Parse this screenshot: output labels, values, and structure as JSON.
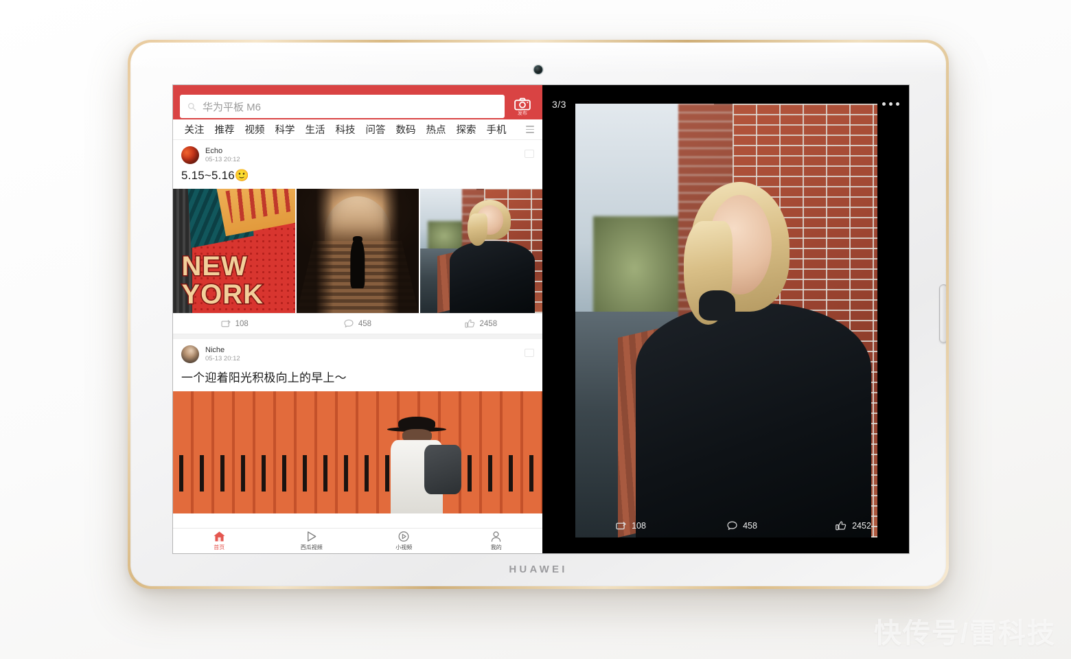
{
  "device": {
    "brand": "HUAWEI",
    "camera_icon": "front-camera",
    "side_button": "power-fingerprint-button"
  },
  "feed_app": {
    "search": {
      "value": "华为平板 M6",
      "icon": "search-icon"
    },
    "publish_button": {
      "label": "发布",
      "icon": "camera-icon"
    },
    "tabs": [
      {
        "label": "关注"
      },
      {
        "label": "推荐"
      },
      {
        "label": "视频"
      },
      {
        "label": "科学"
      },
      {
        "label": "生活"
      },
      {
        "label": "科技"
      },
      {
        "label": "问答"
      },
      {
        "label": "数码"
      },
      {
        "label": "热点"
      },
      {
        "label": "探索"
      },
      {
        "label": "手机"
      }
    ],
    "tab_menu_icon": "hamburger-menu-icon",
    "posts": [
      {
        "author": "Echo",
        "time": "05-13 20:12",
        "text": "5.15~5.16🙂",
        "images": [
          "new-york-poster",
          "stone-stairway",
          "woman-brick-wall"
        ],
        "stats": {
          "shares": "108",
          "comments": "458",
          "likes": "2458"
        }
      },
      {
        "author": "Niche",
        "time": "05-13 20:12",
        "text": "一个迎着阳光积极向上的早上～",
        "images": [
          "man-orange-wall"
        ],
        "stats": {
          "shares": "",
          "comments": "",
          "likes": ""
        }
      }
    ],
    "bottom_nav": [
      {
        "label": "首页",
        "icon": "home-icon",
        "active": true
      },
      {
        "label": "西瓜视频",
        "icon": "play-triangle-icon",
        "active": false
      },
      {
        "label": "小视频",
        "icon": "short-video-icon",
        "active": false
      },
      {
        "label": "我的",
        "icon": "user-icon",
        "active": false
      }
    ]
  },
  "photo_viewer": {
    "counter": "3/3",
    "more_icon": "ellipsis-icon",
    "image": "woman-brick-wall",
    "stats": {
      "shares": "108",
      "comments": "458",
      "likes": "2452"
    }
  },
  "watermark": {
    "text": "快传号/雷科技"
  },
  "colors": {
    "header_red": "#d94343",
    "accent_red": "#e4564f",
    "viewer_black": "#000000",
    "bezel_gold": "#d9b983"
  }
}
